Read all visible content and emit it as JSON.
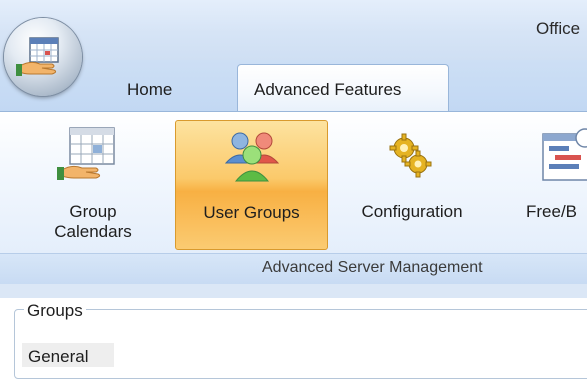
{
  "window": {
    "title": "Office"
  },
  "tabs": [
    {
      "label": "Home",
      "active": false
    },
    {
      "label": "Advanced Features",
      "active": true
    }
  ],
  "ribbon": {
    "buttons": [
      {
        "label_line1": "Group",
        "label_line2": "Calendars",
        "icon": "calendar-hand-icon",
        "selected": false
      },
      {
        "label": "User Groups",
        "icon": "users-group-icon",
        "selected": true
      },
      {
        "label": "Configuration",
        "icon": "gears-icon",
        "selected": false
      },
      {
        "label": "Free/B",
        "icon": "schedule-chart-icon",
        "selected": false
      }
    ],
    "group_label": "Advanced Server Management"
  },
  "groups_panel": {
    "legend": "Groups",
    "items": [
      "General"
    ]
  },
  "colors": {
    "accent_selected": "#fbc96a",
    "ribbon_blue": "#c2d8f3"
  }
}
